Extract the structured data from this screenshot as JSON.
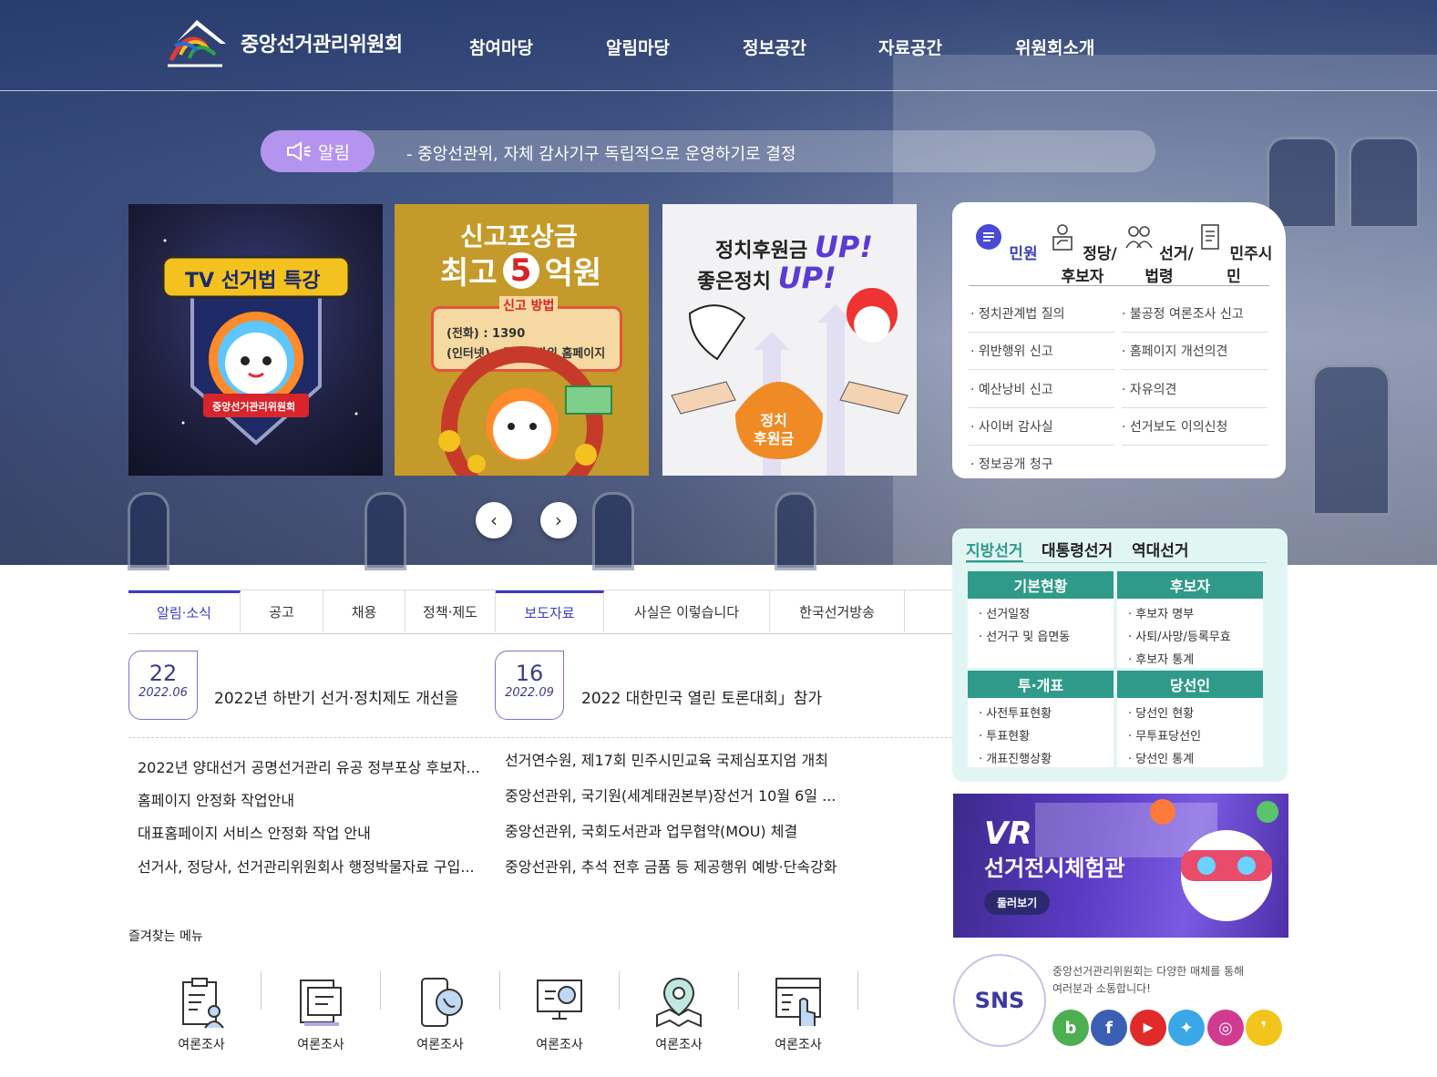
{
  "header": {
    "org_name": "중앙선거관리위원회",
    "nav": [
      "참여마당",
      "알림마당",
      "정보공간",
      "자료공간",
      "위원회소개"
    ]
  },
  "notice": {
    "badge": "알림",
    "text": "- 중앙선관위, 자체 감사기구 독립적으로 운영하기로 결정"
  },
  "slides": {
    "s1": {
      "title": "TV 선거법 특강",
      "org": "중앙선거관리위원회"
    },
    "s2": {
      "title1": "신고포상금",
      "title2a": "최고",
      "title2b": "5",
      "title2c": "억원",
      "method": "신고 방법",
      "phone": "(전화) : 1390",
      "web": "(인터넷) : 중앙선관위 홈페이지"
    },
    "s3": {
      "line1": "정치후원금",
      "line2": "좋은정치",
      "up": "UP!",
      "bag": "정치\n후원금"
    }
  },
  "civil": {
    "tabs": [
      "민원",
      "정당/후보자",
      "선거/법령",
      "민주시민"
    ],
    "left": [
      "정치관계법 질의",
      "위반행위 신고",
      "예산낭비 신고",
      "사이버 감사실",
      "정보공개 청구"
    ],
    "right": [
      "불공정 여론조사 신고",
      "홈페이지 개선의견",
      "자유의견",
      "선거보도 이의신청"
    ]
  },
  "election": {
    "tabs": [
      "지방선거",
      "대통령선거",
      "역대선거"
    ],
    "boxes": [
      {
        "title": "기본현황",
        "items": [
          "선거일정",
          "선거구 및 읍면동"
        ]
      },
      {
        "title": "후보자",
        "items": [
          "후보자 명부",
          "사퇴/사망/등록무효",
          "후보자 통계"
        ]
      },
      {
        "title": "투·개표",
        "items": [
          "사전투표현황",
          "투표현황",
          "개표진행상황"
        ]
      },
      {
        "title": "당선인",
        "items": [
          "당선인 현황",
          "무투표당선인",
          "당선인 통계"
        ]
      }
    ]
  },
  "vr": {
    "title_a": "VR",
    "title_b": "선거전시체험관",
    "button": "둘러보기"
  },
  "sns": {
    "label": "SNS",
    "text1": "중앙선거관리위원회는 다양한 매체를 통해",
    "text2": "여러분과 소통합니다!",
    "icons": [
      {
        "name": "blog",
        "glyph": "b",
        "color": "#4caf50"
      },
      {
        "name": "facebook",
        "glyph": "f",
        "color": "#3b5fb5"
      },
      {
        "name": "youtube",
        "glyph": "▶",
        "color": "#e02a2a"
      },
      {
        "name": "twitter",
        "glyph": "✦",
        "color": "#3aa8e8"
      },
      {
        "name": "instagram",
        "glyph": "◎",
        "color": "#d13b8f"
      },
      {
        "name": "kakao",
        "glyph": "❜",
        "color": "#f3c41c"
      }
    ]
  },
  "news_tabs": [
    "알림·소식",
    "공고",
    "채용",
    "정책·제도",
    "보도자료",
    "사실은 이렇습니다",
    "한국선거방송"
  ],
  "featured": [
    {
      "day": "22",
      "ym": "2022.06",
      "title": "2022년 하반기 선거·정치제도 개선을"
    },
    {
      "day": "16",
      "ym": "2022.09",
      "title": "2022 대한민국 열린 토론대회」참가"
    }
  ],
  "news_left": [
    "2022년 양대선거 공명선거관리 유공 정부포상 후보자...",
    "홈페이지 안정화 작업안내",
    "대표홈페이지 서비스 안정화 작업 안내",
    "선거사, 정당사, 선거관리위원회사 행정박물자료 구입..."
  ],
  "news_right": [
    "선거연수원, 제17회 민주시민교육 국제심포지엄 개최",
    "중앙선관위, 국기원(세계태권본부)장선거 10월 6일 ...",
    "중앙선관위, 국회도서관과 업무협약(MOU) 체결",
    "중앙선관위, 추석 전후 금품 등 제공행위 예방·단속강화"
  ],
  "favorites": {
    "title": "즐겨찾는 메뉴",
    "items": [
      "여론조사",
      "여론조사",
      "여론조사",
      "여론조사",
      "여론조사",
      "여론조사"
    ]
  },
  "colors": {
    "accent": "#3c3cc0",
    "badge": "#b594f0",
    "teal": "#2f9a8a"
  }
}
